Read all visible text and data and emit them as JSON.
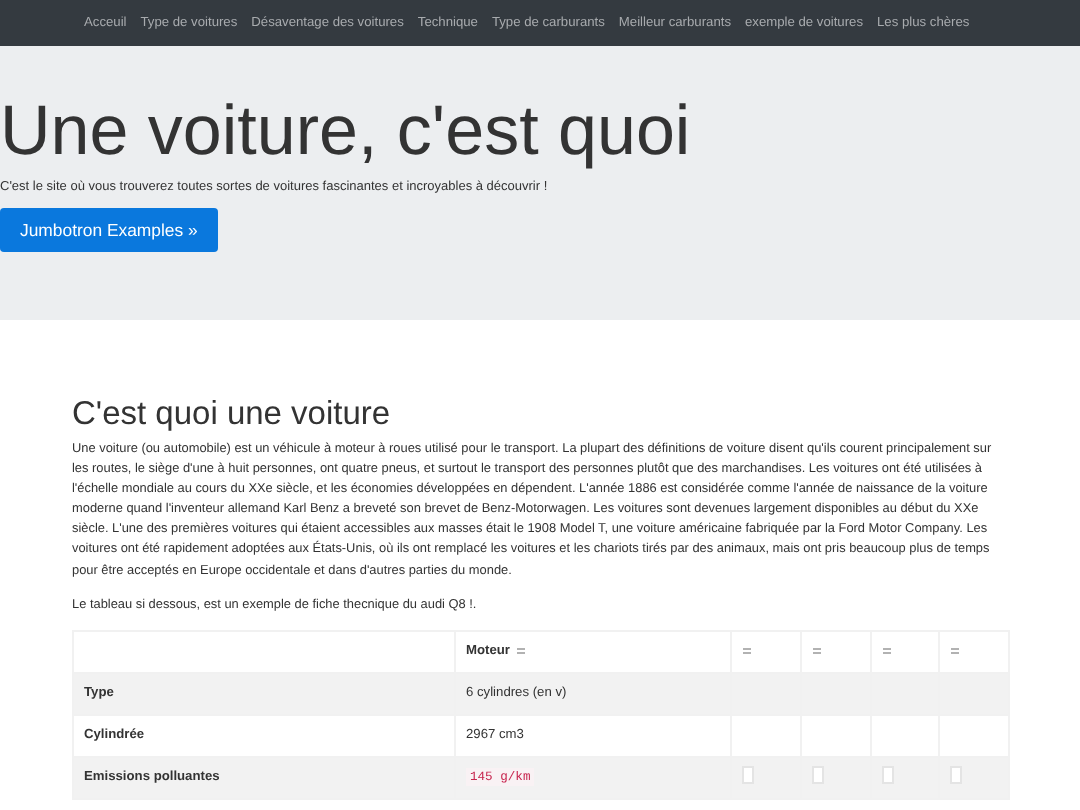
{
  "nav": {
    "links": [
      {
        "label": "Acceuil"
      },
      {
        "label": "Type de voitures"
      },
      {
        "label": "Désaventage des voitures"
      },
      {
        "label": "Technique"
      },
      {
        "label": "Type de carburants"
      },
      {
        "label": "Meilleur carburants"
      },
      {
        "label": "exemple de voitures"
      },
      {
        "label": "Les plus chères"
      }
    ]
  },
  "jumbotron": {
    "title": "Une voiture, c'est quoi",
    "lead": "C'est le site où vous trouverez toutes sortes de voitures fascinantes et incroyables à découvrir !",
    "button": "Jumbotron Examples »"
  },
  "section": {
    "heading": "C'est quoi une voiture",
    "paragraph": "Une voiture (ou automobile) est un véhicule à moteur à roues utilisé pour le transport. La plupart des définitions de voiture disent qu'ils courent principalement sur les routes, le siège d'une à huit personnes, ont quatre pneus, et surtout le transport des personnes plutôt que des marchandises. Les voitures ont été utilisées à l'échelle mondiale au cours du XXe siècle, et les économies développées en dépendent. L'année 1886 est considérée comme l'année de naissance de la voiture moderne quand l'inventeur allemand Karl Benz a breveté son brevet de Benz-Motorwagen. Les voitures sont devenues largement disponibles au début du XXe siècle. L'une des premières voitures qui étaient accessibles aux masses était le 1908 Model T, une voiture américaine fabriquée par la Ford Motor Company. Les voitures ont été rapidement adoptées aux États-Unis, où ils ont remplacé les voitures et les chariots tirés par des animaux, mais ont pris beaucoup plus de temps pour être acceptés en Europe occidentale et dans d'autres parties du monde.",
    "note": "Le tableau si dessous, est un exemple de fiche thecnique du audi Q8 !."
  },
  "table": {
    "columns": [
      {},
      {
        "label": "Moteur"
      },
      {},
      {},
      {},
      {}
    ],
    "rows": [
      {
        "label": "Type",
        "value": "6 cylindres (en v)",
        "kind": "text"
      },
      {
        "label": "Cylindrée",
        "value": "2967 cm3",
        "kind": "text"
      },
      {
        "label": "Emissions polluantes",
        "value": "145 g/km",
        "kind": "code"
      }
    ]
  }
}
